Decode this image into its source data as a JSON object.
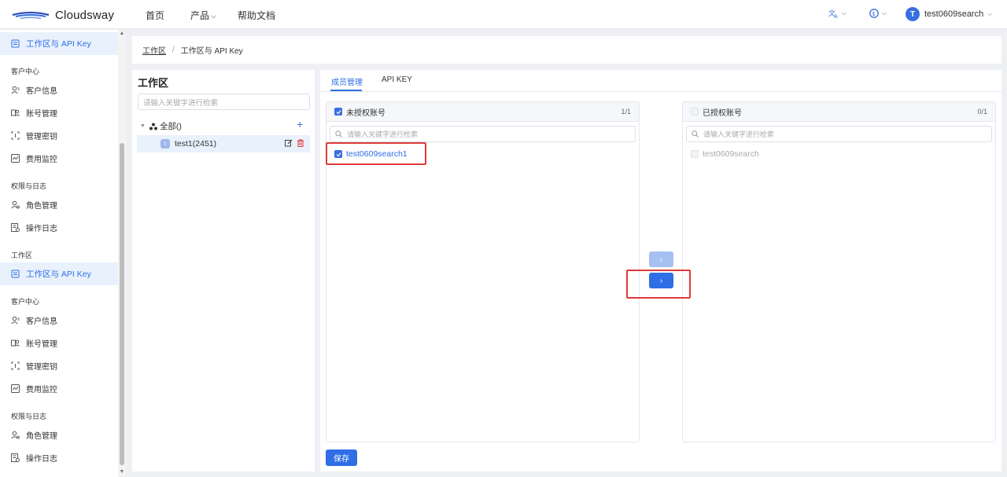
{
  "app": {
    "name": "Cloudsway"
  },
  "topnav": {
    "home": "首页",
    "products": "产品",
    "docs": "帮助文档"
  },
  "user": {
    "initial": "T",
    "name": "test0609search"
  },
  "sidebar": {
    "active_top": "工作区与 API Key",
    "group1": {
      "title": "客户中心",
      "items": [
        "客户信息",
        "账号管理",
        "管理密钥",
        "费用监控"
      ]
    },
    "group2": {
      "title": "权限与日志",
      "items": [
        "角色管理",
        "操作日志"
      ]
    },
    "group3": {
      "title": "工作区",
      "active": "工作区与 API Key"
    },
    "group4": {
      "title": "客户中心",
      "items": [
        "客户信息",
        "账号管理",
        "管理密钥",
        "费用监控"
      ]
    },
    "group5": {
      "title": "权限与日志",
      "items": [
        "角色管理",
        "操作日志"
      ]
    }
  },
  "breadcrumb": {
    "root": "工作区",
    "sep": "/",
    "current": "工作区与 API Key"
  },
  "workspace": {
    "title": "工作区",
    "search_placeholder": "请输入关键字进行检索",
    "root": "全部()",
    "node_badge": "t",
    "node_label": "test1(2451)"
  },
  "tabs": {
    "members": "成员管理",
    "apikey": "API KEY"
  },
  "left_list": {
    "title": "未授权账号",
    "count": "1/1",
    "search_placeholder": "请输入关键字进行检索",
    "items": [
      "test0609search1"
    ]
  },
  "right_list": {
    "title": "已授权账号",
    "count": "0/1",
    "search_placeholder": "请输入关键字进行检索",
    "items": [
      "test0609search"
    ]
  },
  "transfer": {
    "left_glyph": "‹",
    "right_glyph": "›"
  },
  "save_label": "保存",
  "colors": {
    "accent": "#2f6ee6",
    "highlight": "#e03a3a"
  }
}
